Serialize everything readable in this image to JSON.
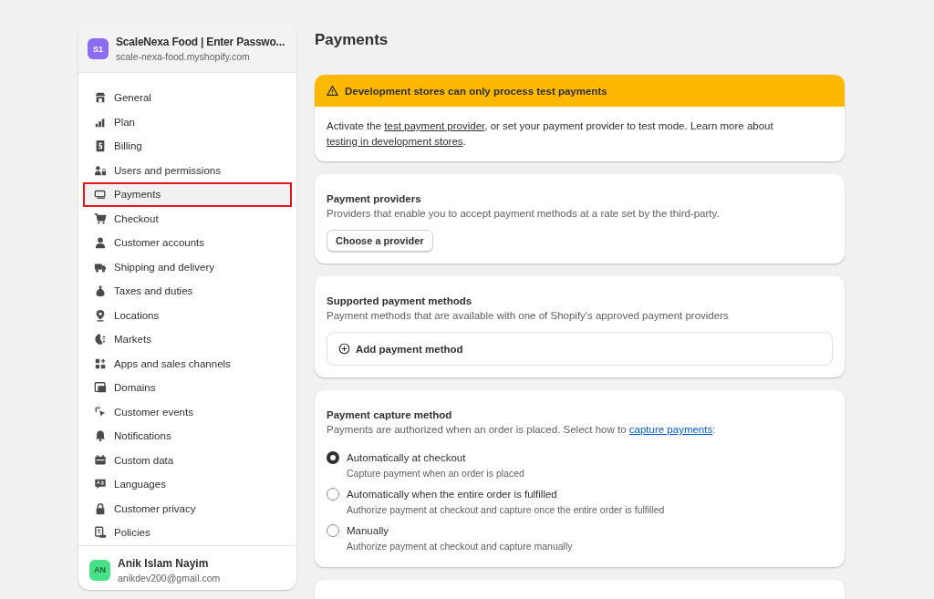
{
  "store": {
    "avatar": "S1",
    "name": "ScaleNexa Food | Enter Passwo...",
    "domain": "scale-nexa-food.myshopify.com"
  },
  "nav": [
    {
      "label": "General",
      "selected": false,
      "highlighted": false
    },
    {
      "label": "Plan",
      "selected": false,
      "highlighted": false
    },
    {
      "label": "Billing",
      "selected": false,
      "highlighted": false
    },
    {
      "label": "Users and permissions",
      "selected": false,
      "highlighted": false
    },
    {
      "label": "Payments",
      "selected": true,
      "highlighted": true
    },
    {
      "label": "Checkout",
      "selected": false,
      "highlighted": false
    },
    {
      "label": "Customer accounts",
      "selected": false,
      "highlighted": false
    },
    {
      "label": "Shipping and delivery",
      "selected": false,
      "highlighted": false
    },
    {
      "label": "Taxes and duties",
      "selected": false,
      "highlighted": false
    },
    {
      "label": "Locations",
      "selected": false,
      "highlighted": false
    },
    {
      "label": "Markets",
      "selected": false,
      "highlighted": false
    },
    {
      "label": "Apps and sales channels",
      "selected": false,
      "highlighted": false
    },
    {
      "label": "Domains",
      "selected": false,
      "highlighted": false
    },
    {
      "label": "Customer events",
      "selected": false,
      "highlighted": false
    },
    {
      "label": "Notifications",
      "selected": false,
      "highlighted": false
    },
    {
      "label": "Custom data",
      "selected": false,
      "highlighted": false
    },
    {
      "label": "Languages",
      "selected": false,
      "highlighted": false
    },
    {
      "label": "Customer privacy",
      "selected": false,
      "highlighted": false
    },
    {
      "label": "Policies",
      "selected": false,
      "highlighted": false
    }
  ],
  "user": {
    "avatar": "AN",
    "name": "Anik Islam Nayim",
    "email": "anikdev200@gmail.com"
  },
  "page_title": "Payments",
  "banner": {
    "title": "Development stores can only process test payments",
    "body": [
      {
        "kind": "text",
        "text": "Activate the "
      },
      {
        "kind": "link",
        "text": "test payment provider"
      },
      {
        "kind": "text",
        "text": ", or set your payment provider to test mode. Learn more about "
      },
      {
        "kind": "link",
        "text": "testing in development stores"
      },
      {
        "kind": "text",
        "text": "."
      }
    ]
  },
  "providers": {
    "title": "Payment providers",
    "description": "Providers that enable you to accept payment methods at a rate set by the third-party.",
    "button": "Choose a provider"
  },
  "supported": {
    "title": "Supported payment methods",
    "description": "Payment methods that are available with one of Shopify's approved payment providers",
    "add_button": "Add payment method"
  },
  "capture": {
    "title": "Payment capture method",
    "description": [
      {
        "kind": "text",
        "text": "Payments are authorized when an order is placed. Select how to "
      },
      {
        "kind": "link",
        "text": "capture payments"
      },
      {
        "kind": "text",
        "text": ":"
      }
    ],
    "options": [
      {
        "label": "Automatically at checkout",
        "hint": "Capture payment when an order is placed",
        "selected": true
      },
      {
        "label": "Automatically when the entire order is fulfilled",
        "hint": "Authorize payment at checkout and capture once the entire order is fulfilled",
        "selected": false
      },
      {
        "label": "Manually",
        "hint": "Authorize payment at checkout and capture manually",
        "selected": false
      }
    ]
  }
}
